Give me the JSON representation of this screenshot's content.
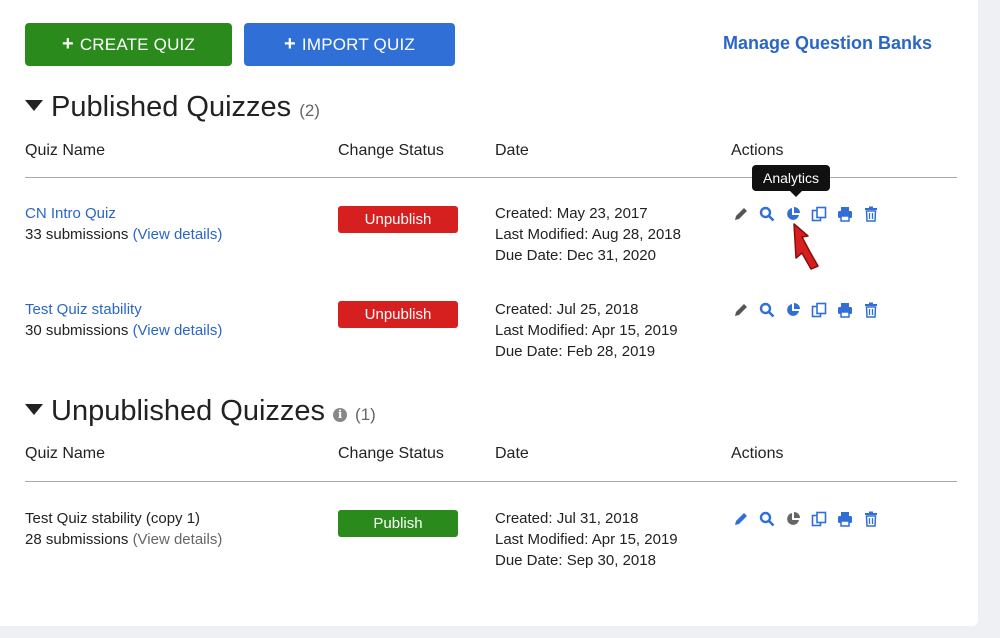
{
  "toolbar": {
    "create_label": "CREATE QUIZ",
    "import_label": "IMPORT QUIZ",
    "plus": "+",
    "manage_label": "Manage Question Banks"
  },
  "published": {
    "title": "Published Quizzes",
    "count": "(2)",
    "columns": [
      "Quiz Name",
      "Change Status",
      "Date",
      "Actions"
    ],
    "rows": [
      {
        "name": "CN Intro Quiz",
        "submissions": "33 submissions",
        "details": "(View details)",
        "status": "Unpublish",
        "created": "Created: May 23, 2017",
        "modified": "Last Modified: Aug 28, 2018",
        "due": "Due Date: Dec 31, 2020"
      },
      {
        "name": "Test Quiz stability",
        "submissions": "30 submissions",
        "details": "(View details)",
        "status": "Unpublish",
        "created": "Created: Jul 25, 2018",
        "modified": "Last Modified: Apr 15, 2019",
        "due": "Due Date: Feb 28, 2019"
      }
    ]
  },
  "unpublished": {
    "title": "Unpublished Quizzes",
    "info_glyph": "i",
    "count": "(1)",
    "columns": [
      "Quiz Name",
      "Change Status",
      "Date",
      "Actions"
    ],
    "rows": [
      {
        "name": "Test Quiz stability (copy 1)",
        "submissions": "28 submissions",
        "details": "(View details)",
        "status": "Publish",
        "created": "Created: Jul 31, 2018",
        "modified": "Last Modified: Apr 15, 2019",
        "due": "Due Date: Sep 30, 2018"
      }
    ]
  },
  "tooltip": "Analytics",
  "icons": [
    "pencil-icon",
    "search-icon",
    "pie-chart-icon",
    "copy-icon",
    "print-icon",
    "trash-icon"
  ],
  "colors": {
    "accent_blue": "#2f6fd6",
    "link_blue": "#2a66c8",
    "create_green": "#2a8a1c",
    "unpublish_red": "#d6201f",
    "publish_green": "#2a8a1c"
  }
}
